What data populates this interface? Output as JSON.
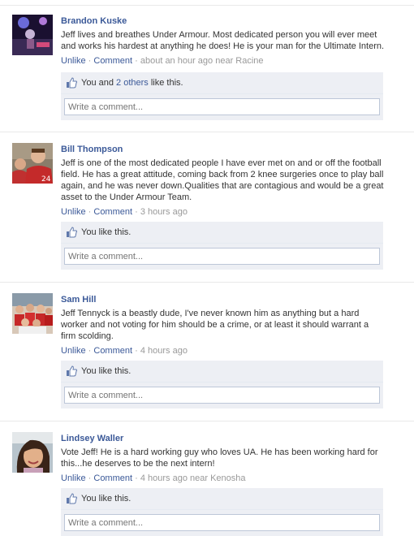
{
  "posts": [
    {
      "author": "Brandon Kuske",
      "message": "Jeff lives and breathes Under Armour. Most dedicated person you will ever meet and works his hardest at anything he does! He is your man for the Ultimate Intern.",
      "unlike": "Unlike",
      "comment": "Comment",
      "time": "about an hour ago near Racine",
      "like_prefix": "You and ",
      "like_link": "2 others",
      "like_suffix": " like this.",
      "comment_placeholder": "Write a comment..."
    },
    {
      "author": "Bill Thompson",
      "message": "Jeff is one of the most dedicated people I have ever met on and or off the football field. He has a great attitude, coming back from 2 knee surgeries once to play ball again, and he was never down.Qualities that are contagious and would be a great asset to the Under Armour Team.",
      "unlike": "Unlike",
      "comment": "Comment",
      "time": "3 hours ago",
      "like_prefix": "You like this.",
      "like_link": "",
      "like_suffix": "",
      "comment_placeholder": "Write a comment..."
    },
    {
      "author": "Sam Hill",
      "message": "Jeff Tennyck is a beastly dude, I've never known him as anything but a hard worker and not voting for him should be a crime, or at least it should warrant a firm scolding.",
      "unlike": "Unlike",
      "comment": "Comment",
      "time": "4 hours ago",
      "like_prefix": "You like this.",
      "like_link": "",
      "like_suffix": "",
      "comment_placeholder": "Write a comment..."
    },
    {
      "author": "Lindsey Waller",
      "message": "Vote Jeff! He is a hard working guy who loves UA. He has been working hard for this...he deserves to be the next intern!",
      "unlike": "Unlike",
      "comment": "Comment",
      "time": "4 hours ago near Kenosha",
      "like_prefix": "You like this.",
      "like_link": "",
      "like_suffix": "",
      "comment_placeholder": "Write a comment..."
    }
  ],
  "colors": {
    "link": "#3b5998",
    "like_bg": "#edeff4",
    "meta": "#999999"
  },
  "icons": {
    "like": "thumbs-up-icon"
  }
}
